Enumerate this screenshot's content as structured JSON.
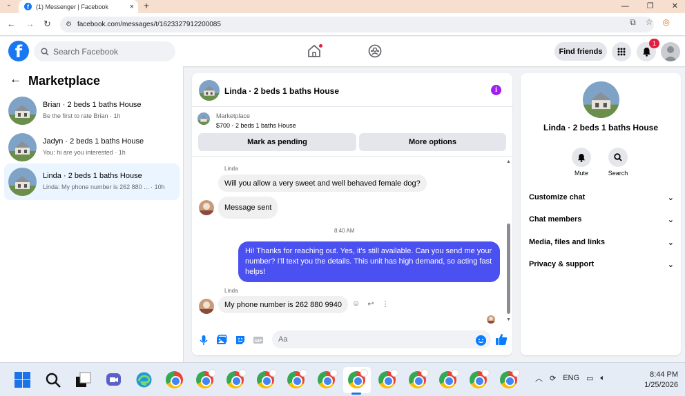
{
  "browser": {
    "tab_title": "(1) Messenger | Facebook",
    "new_tab": "+",
    "tab_close": "×",
    "url": "facebook.com/messages/t/1623327912200085"
  },
  "facebook": {
    "logo": "f",
    "search_placeholder": "Search Facebook",
    "find_friends": "Find friends",
    "notification_count": "1"
  },
  "left_panel": {
    "back": "←",
    "title": "Marketplace",
    "conversations": [
      {
        "name": "Brian · 2 beds 1 baths House",
        "preview": "Be the first to rate Brian · 1h"
      },
      {
        "name": "Jadyn · 2 beds 1 baths House",
        "preview": "You: hi are you interested · 1h"
      },
      {
        "name": "Linda · 2 beds 1 baths House",
        "preview": "Linda: My phone number is 262 880 ... · 10h"
      }
    ]
  },
  "chat": {
    "title": "Linda · 2 beds 1 baths House",
    "info": "i",
    "marketplace_label": "Marketplace",
    "listing": "$700 - 2 beds 1 baths House",
    "mark_pending": "Mark as pending",
    "more_options": "More options",
    "messages": [
      {
        "sender": "Linda",
        "text": "Will you allow a very sweet and well behaved female dog?"
      },
      {
        "text": "Message sent"
      },
      {
        "timestamp": "8:40 AM"
      },
      {
        "text": "Hi! Thanks for reaching out. Yes, it's still available. Can you send me your number? I'll text you the details. This unit has high demand, so acting fast helps!"
      },
      {
        "sender": "Linda",
        "text": "My phone number is 262 880 9940"
      }
    ],
    "composer_placeholder": "Aa"
  },
  "right_panel": {
    "name": "Linda · 2 beds 1 baths House",
    "actions": [
      {
        "label": "Mute"
      },
      {
        "label": "Search"
      }
    ],
    "sections": [
      "Customize chat",
      "Chat members",
      "Media, files and links",
      "Privacy & support"
    ]
  },
  "taskbar": {
    "language": "ENG",
    "time": "8:44 PM",
    "date": "1/25/2026"
  },
  "colors": {
    "facebook_blue": "#1877f2",
    "outgoing_bubble": "#4b50f1",
    "info_purple": "#a020f0",
    "notification_red": "#e41e3f"
  }
}
